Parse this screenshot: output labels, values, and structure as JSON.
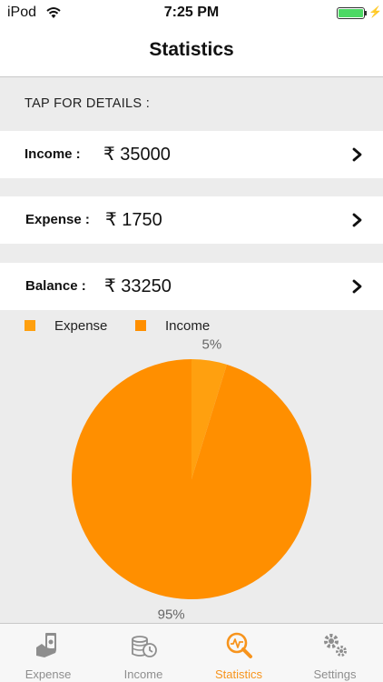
{
  "status_bar": {
    "carrier": "iPod",
    "time": "7:25 PM"
  },
  "nav": {
    "title": "Statistics"
  },
  "section": {
    "header": "TAP FOR DETAILS :"
  },
  "rows": {
    "income": {
      "label": "Income :",
      "value": "₹ 35000"
    },
    "expense": {
      "label": "Expense :",
      "value": "₹ 1750"
    },
    "balance": {
      "label": "Balance :",
      "value": "₹ 33250"
    }
  },
  "chart_data": {
    "type": "pie",
    "legend": [
      "Expense",
      "Income"
    ],
    "legend_position": "top-left",
    "slices": [
      {
        "name": "Expense",
        "value": 1750,
        "percent_label": "5%",
        "color": "#ffa00f"
      },
      {
        "name": "Income",
        "value": 35000,
        "percent_label": "95%",
        "color": "#ff8f00"
      }
    ]
  },
  "tabs": [
    {
      "label": "Expense",
      "icon": "expense-money-hand-icon",
      "active": false
    },
    {
      "label": "Income",
      "icon": "income-coins-clock-icon",
      "active": false
    },
    {
      "label": "Statistics",
      "icon": "statistics-magnifier-pulse-icon",
      "active": true
    },
    {
      "label": "Settings",
      "icon": "settings-gears-icon",
      "active": false
    }
  ],
  "colors": {
    "accent": "#f7941d",
    "inactive_tab": "#8e8e8e",
    "battery": "#4cd964"
  }
}
